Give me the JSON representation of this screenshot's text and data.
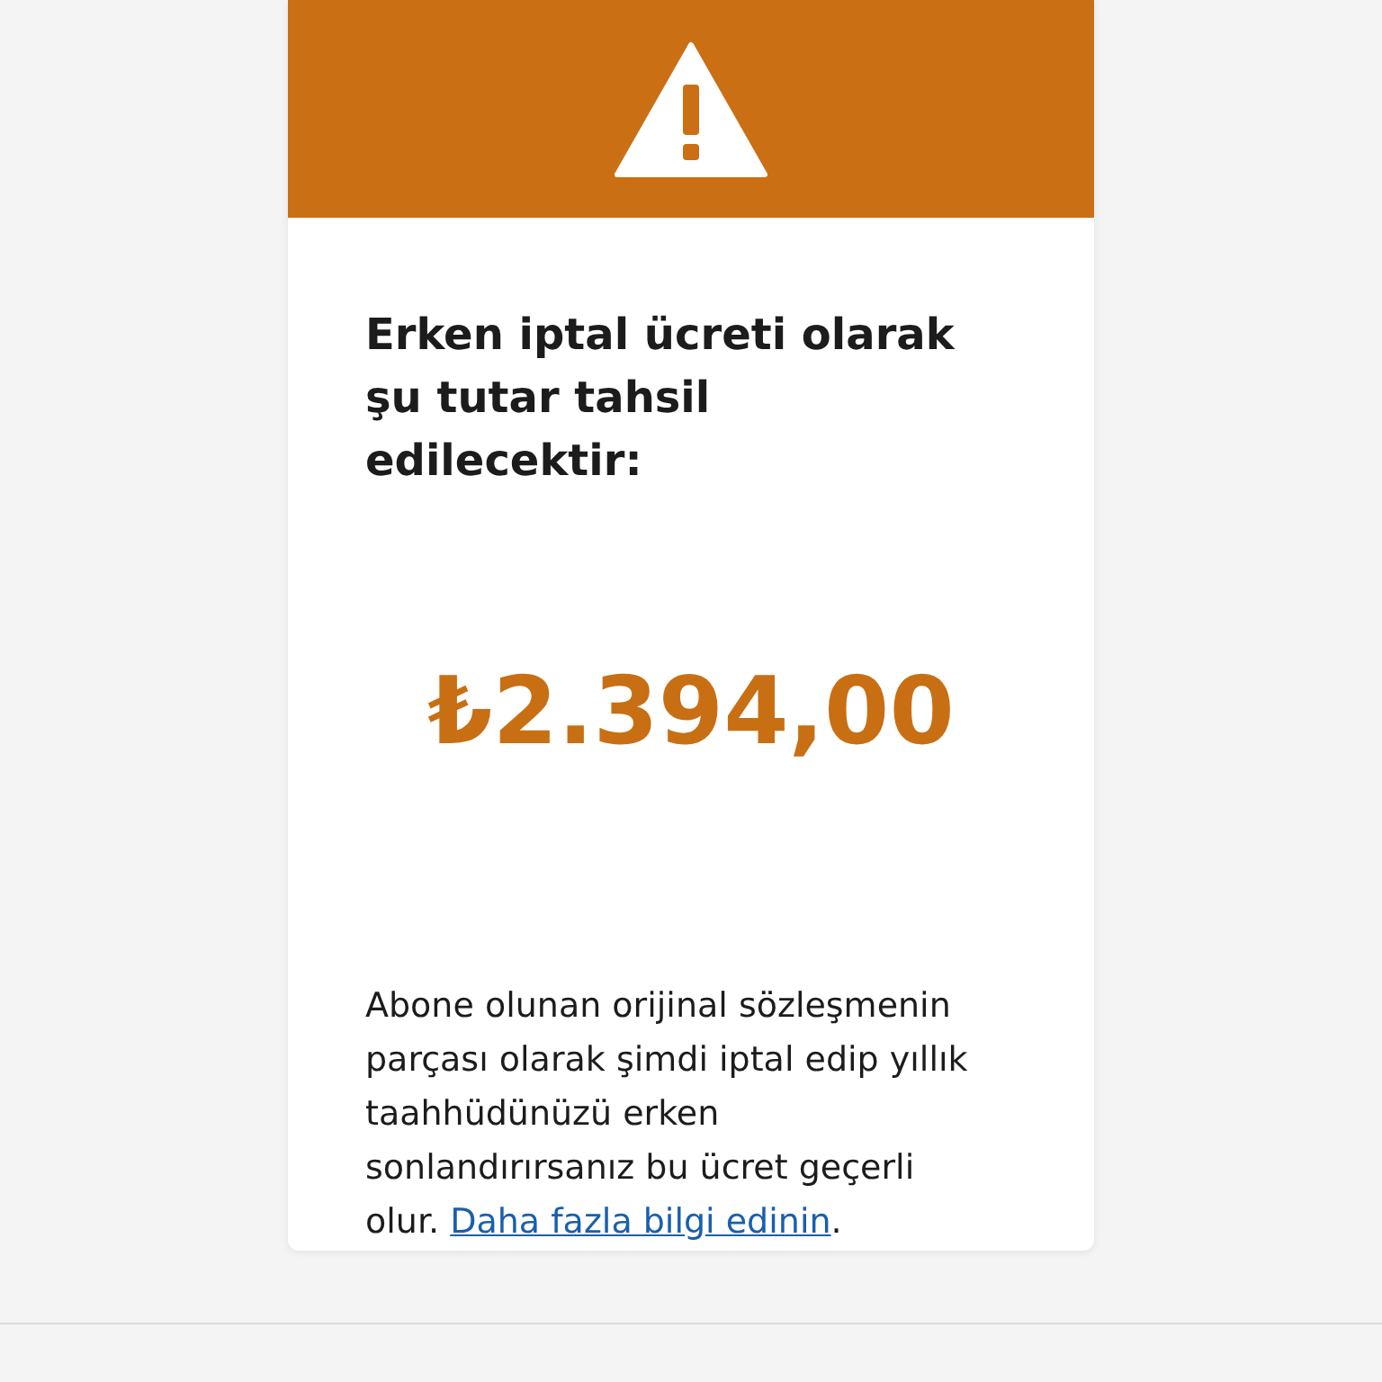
{
  "alert": {
    "heading": "Erken iptal ücreti olarak şu tutar tahsil edilecektir:",
    "amount": "₺2.394,00",
    "body": "Abone olunan orijinal sözleşmenin parçası olarak şimdi iptal edip yıllık taahhüdünüzü erken sonlandırırsanız bu ücret geçerli olur.",
    "link": "Daha fazla bilgi edinin",
    "after_link": "."
  }
}
